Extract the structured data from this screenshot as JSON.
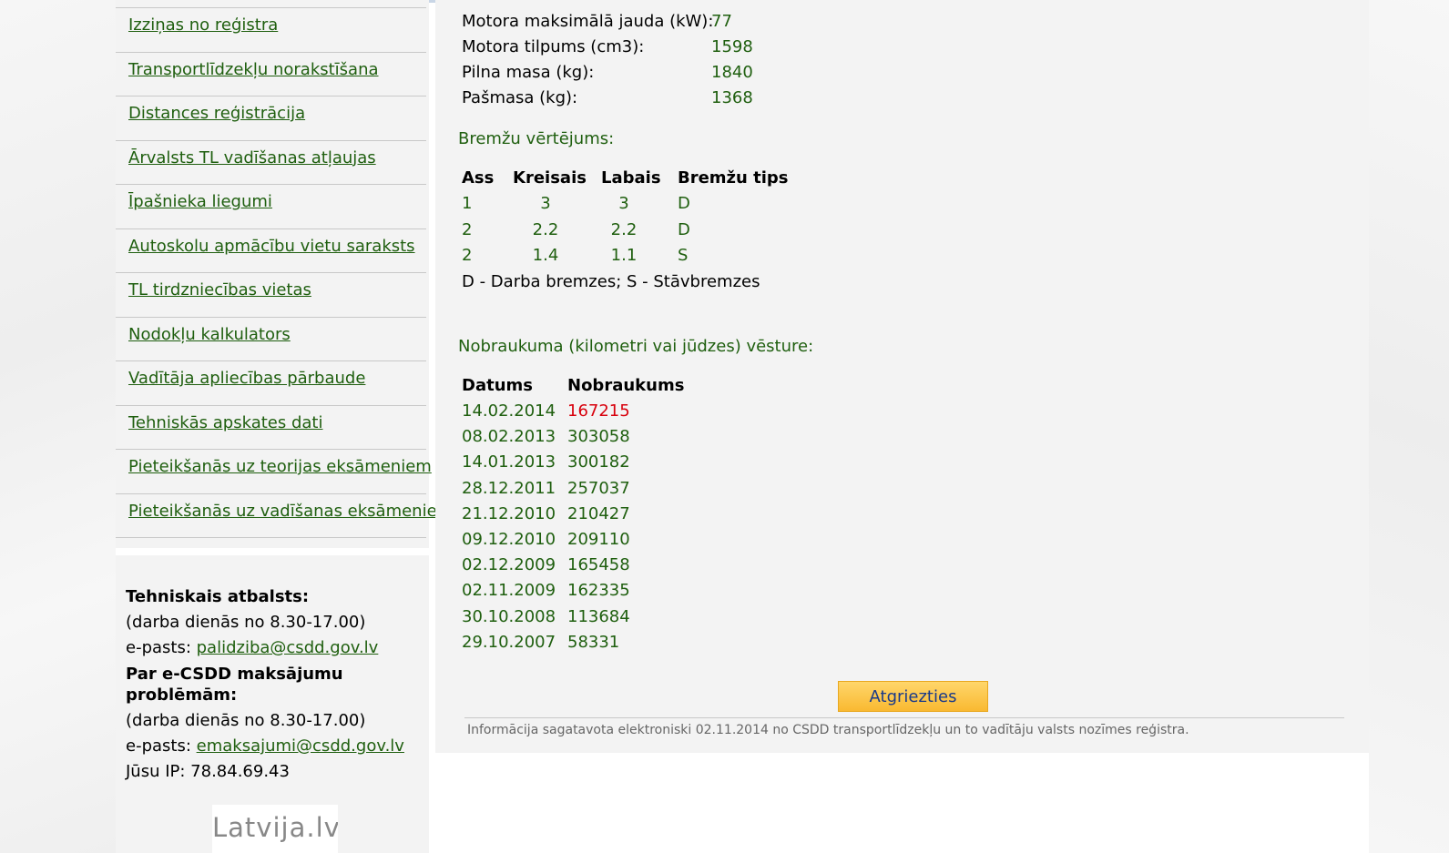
{
  "sidebar": {
    "nav": [
      "Izziņas no reģistra",
      "Transportlīdzekļu norakstīšana",
      "Distances reģistrācija",
      "Ārvalsts TL vadīšanas atļaujas",
      "Īpašnieka liegumi",
      "Autoskolu apmācību vietu saraksts",
      "TL tirdzniecības vietas",
      "Nodokļu kalkulators",
      "Vadītāja apliecības pārbaude",
      "Tehniskās apskates dati",
      "Pieteikšanās uz teorijas eksāmeniem",
      "Pieteikšanās uz vadīšanas eksāmeniem"
    ],
    "support": {
      "tech_title": "Tehniskais atbalsts:",
      "tech_hours": "(darba dienās no 8.30-17.00)",
      "tech_email_label": "e-pasts: ",
      "tech_email": "palidziba@csdd.gov.lv",
      "pay_title": "Par e-CSDD maksājumu problēmām:",
      "pay_hours": "(darba dienās no 8.30-17.00)",
      "pay_email_label": "e-pasts: ",
      "pay_email": "emaksajumi@csdd.gov.lv",
      "ip": "Jūsu IP: 78.84.69.43"
    },
    "logo_text": "Latvija.lv"
  },
  "specs": [
    {
      "label": "Motora maksimālā jauda (kW):",
      "value": "77"
    },
    {
      "label": "Motora tilpums (cm3):",
      "value": "1598"
    },
    {
      "label": "Pilna masa (kg):",
      "value": "1840"
    },
    {
      "label": "Pašmasa (kg):",
      "value": "1368"
    }
  ],
  "brakes": {
    "title": "Bremžu vērtējums:",
    "headers": [
      "Ass",
      "Kreisais",
      "Labais",
      "Bremžu tips"
    ],
    "rows": [
      [
        "1",
        "3",
        "3",
        "D"
      ],
      [
        "2",
        "2.2",
        "2.2",
        "D"
      ],
      [
        "2",
        "1.4",
        "1.1",
        "S"
      ]
    ],
    "note": "D - Darba bremzes; S - Stāvbremzes"
  },
  "mileage": {
    "title": "Nobraukuma (kilometri vai jūdzes) vēsture:",
    "headers": [
      "Datums",
      "Nobraukums"
    ],
    "rows": [
      {
        "date": "14.02.2014",
        "km": "167215",
        "highlight": true
      },
      {
        "date": "08.02.2013",
        "km": "303058"
      },
      {
        "date": "14.01.2013",
        "km": "300182"
      },
      {
        "date": "28.12.2011",
        "km": "257037"
      },
      {
        "date": "21.12.2010",
        "km": "210427"
      },
      {
        "date": "09.12.2010",
        "km": "209110"
      },
      {
        "date": "02.12.2009",
        "km": "165458"
      },
      {
        "date": "02.11.2009",
        "km": "162335"
      },
      {
        "date": "30.10.2008",
        "km": "113684"
      },
      {
        "date": "29.10.2007",
        "km": "58331"
      }
    ]
  },
  "back_button": "Atgriezties",
  "footer": "Informācija sagatavota elektroniski 02.11.2014 no CSDD transportlīdzekļu un to vadītāju valsts nozīmes reģistra.",
  "colors": {
    "link": "#1f5f0f",
    "value": "#1f5f0f",
    "highlight": "#d8000c",
    "button": "#f9b931"
  }
}
